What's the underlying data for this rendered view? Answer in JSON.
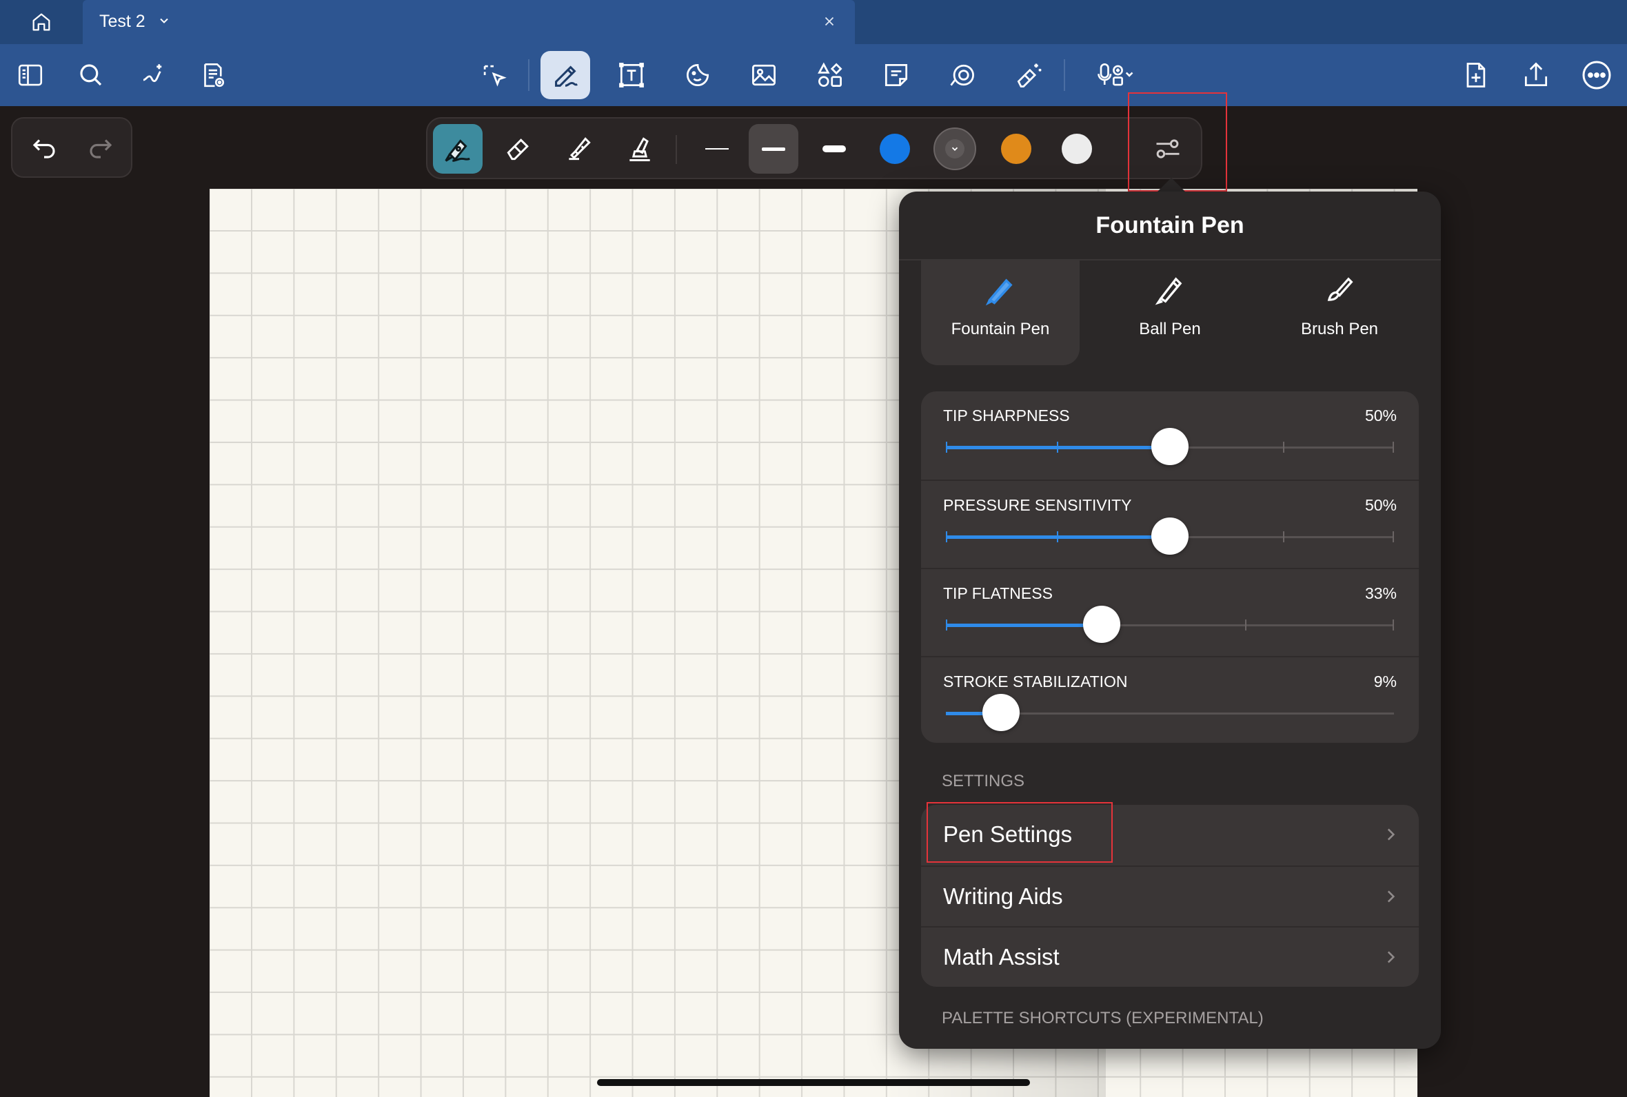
{
  "tab_bar": {
    "home_icon": "home-icon",
    "document_tab": {
      "title": "Test 2",
      "chevron_icon": "chevron-down-icon",
      "close_icon": "close-icon"
    }
  },
  "toolbar": {
    "left": [
      "sidebar-icon",
      "search-icon",
      "ai-sparkle-icon",
      "document-view-icon"
    ],
    "center": [
      "lasso-icon",
      "pen-icon",
      "text-box-icon",
      "sticker-icon",
      "image-icon",
      "shapes-icon",
      "sticky-note-icon",
      "laser-pointer-icon",
      "magic-eraser-icon",
      "microphone-icon"
    ],
    "right": [
      "add-page-icon",
      "share-icon",
      "more-icon"
    ]
  },
  "undo_redo": {
    "undo_icon": "undo-icon",
    "redo_icon": "redo-icon"
  },
  "pen_toolbar": {
    "tools": [
      "fountain-pen-icon",
      "eraser-icon",
      "highlighter-icon",
      "marker-icon"
    ],
    "widths": [
      "thin",
      "medium",
      "thick"
    ],
    "colors": [
      "#1479e6",
      "#5a5555",
      "#e08a1a",
      "#ececec"
    ],
    "settings_icon": "sliders-icon"
  },
  "popover": {
    "title": "Fountain Pen",
    "pen_types": [
      {
        "label": "Fountain Pen",
        "selected": true
      },
      {
        "label": "Ball Pen",
        "selected": false
      },
      {
        "label": "Brush Pen",
        "selected": false
      }
    ],
    "sliders": [
      {
        "label": "TIP SHARPNESS",
        "value_text": "50%",
        "value": 50
      },
      {
        "label": "PRESSURE SENSITIVITY",
        "value_text": "50%",
        "value": 50
      },
      {
        "label": "TIP FLATNESS",
        "value_text": "33%",
        "value": 33
      },
      {
        "label": "STROKE STABILIZATION",
        "value_text": "9%",
        "value": 9
      }
    ],
    "settings_header": "SETTINGS",
    "settings_items": [
      "Pen Settings",
      "Writing Aids",
      "Math Assist"
    ],
    "palette_header": "PALETTE SHORTCUTS (EXPERIMENTAL)"
  },
  "colors": {
    "header": "#2d5591",
    "accent": "#2f8be9",
    "panel": "#2b2828",
    "highlight": "#e5333a"
  }
}
